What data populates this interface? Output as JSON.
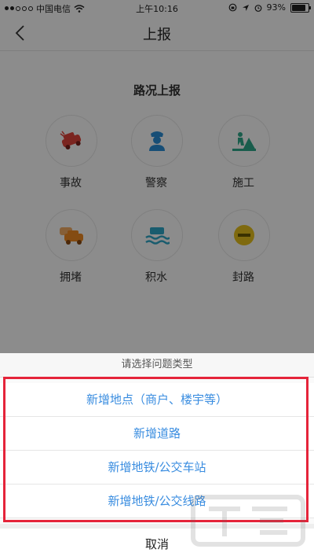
{
  "status_bar": {
    "carrier": "中国电信",
    "time": "上午10:16",
    "battery": "93%"
  },
  "navbar": {
    "title": "上报"
  },
  "section": {
    "title": "路况上报",
    "items": [
      {
        "label": "事故",
        "icon": "car-crash-icon",
        "color": "#e0443b"
      },
      {
        "label": "警察",
        "icon": "police-icon",
        "color": "#2b8fd8"
      },
      {
        "label": "施工",
        "icon": "construction-icon",
        "color": "#2fa98a"
      },
      {
        "label": "拥堵",
        "icon": "traffic-jam-icon",
        "color": "#f08a24"
      },
      {
        "label": "积水",
        "icon": "flooding-icon",
        "color": "#2fa8c8"
      },
      {
        "label": "封路",
        "icon": "road-closed-icon",
        "color": "#e8c21c"
      }
    ]
  },
  "action_sheet": {
    "prompt": "请选择问题类型",
    "options": [
      "新增地点（商户、楼宇等）",
      "新增道路",
      "新增地铁/公交车站",
      "新增地铁/公交线路"
    ],
    "cancel": "取消"
  }
}
